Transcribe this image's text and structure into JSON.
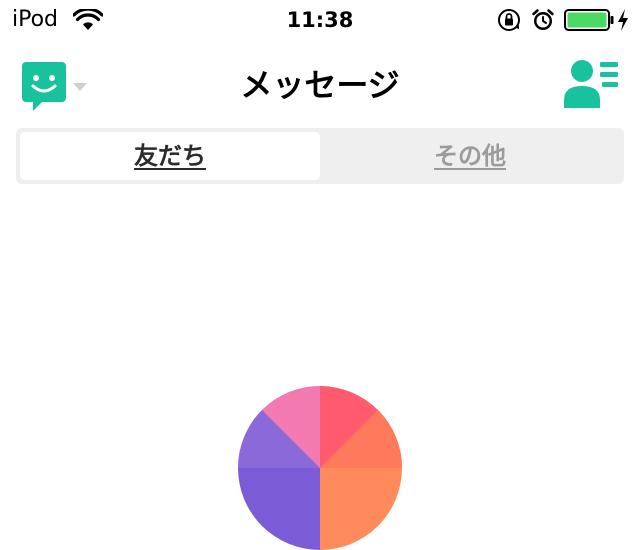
{
  "status_bar": {
    "carrier": "iPod",
    "time": "11:38"
  },
  "nav": {
    "title": "メッセージ",
    "left_icon": "message-bubble-icon",
    "right_icon": "contacts-list-icon",
    "accent_color": "#18c29c"
  },
  "segments": {
    "friends": "友だち",
    "others": "その他",
    "selected": "friends"
  },
  "colors": {
    "accent": "#18c29c",
    "battery": "#4cd964",
    "inactive_text": "#9b9b9b",
    "segment_bg": "#efefef"
  }
}
